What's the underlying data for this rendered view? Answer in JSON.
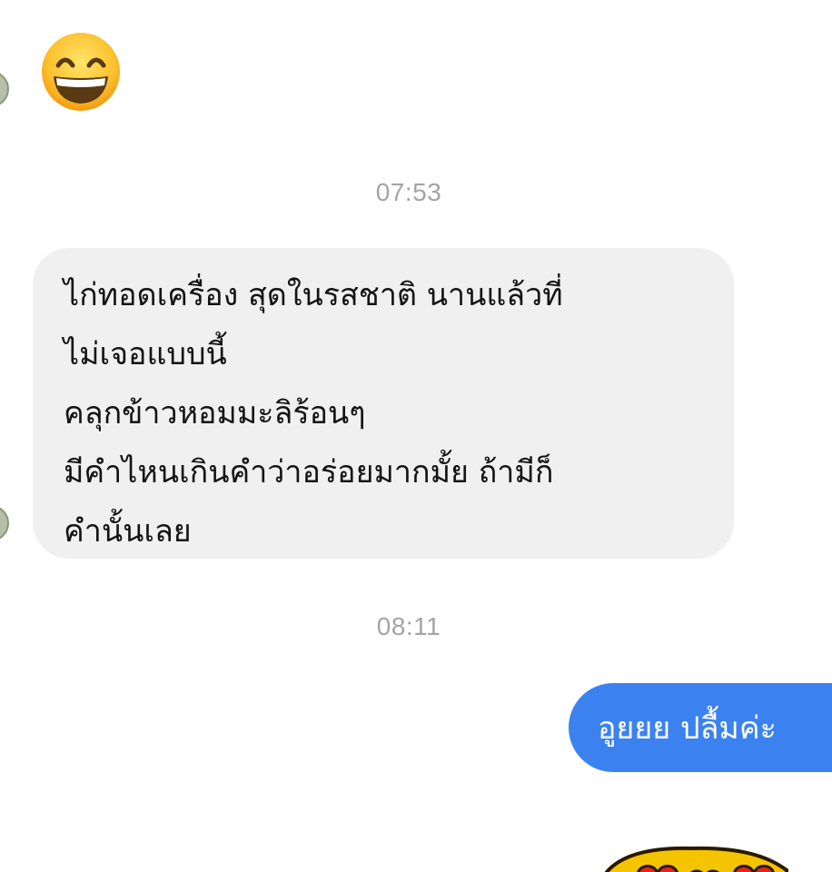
{
  "conversation": {
    "avatar_color": "#b7bfa8",
    "bubble_in_color": "#f0f0f0",
    "bubble_out_color": "#3b82f0",
    "emoji_message": {
      "icon": "grinning-face-emoji"
    },
    "timestamps": [
      "07:53",
      "08:11"
    ],
    "incoming_message": {
      "lines": [
        "ไก่ทอดเครื่อง สุดในรสชาติ นานแล้วที่",
        "ไม่เจอแบบนี้",
        "คลุกข้าวหอมมะลิร้อนๆ",
        "มีคำไหนเกินคำว่าอร่อยมากมั้ย ถ้ามีก็",
        "คำนั้นเลย"
      ]
    },
    "outgoing_message": {
      "text": "อูยยย ปลื้มค่ะ"
    },
    "sticker": {
      "icon": "hearts-sticker"
    }
  }
}
